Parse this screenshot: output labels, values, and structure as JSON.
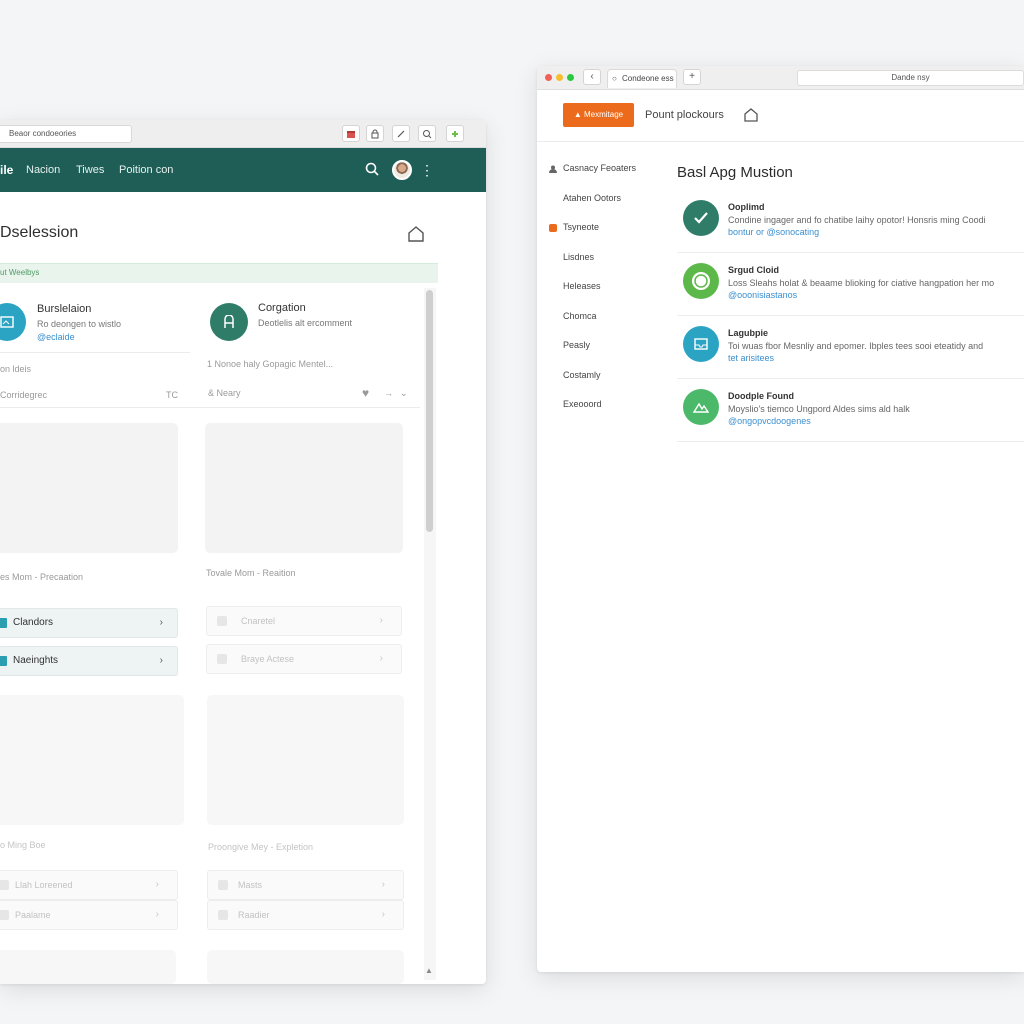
{
  "left_window": {
    "address": "Beaor condoeories",
    "chrome_icons": [
      "calendar-icon",
      "lock-icon",
      "tools-icon",
      "search-icon",
      "extension-icon"
    ],
    "app_logo": "ile",
    "nav": [
      "Nacion",
      "Tiwes",
      "Poition con"
    ],
    "page_title": "Dselession",
    "banner": "ut Weelbys",
    "card_a": {
      "title": "Burslelaion",
      "subtitle": "Ro deongen to wistlo",
      "link": "@eclaide"
    },
    "card_b": {
      "title": "Corgation",
      "subtitle": "Deotlelis alt ercomment"
    },
    "row_a_label": "on ldeis",
    "row_b_text": "1 Nonoe haly Gopagic Mentel...",
    "filter_a_label": "Corridegrec",
    "filter_a_value": "TC",
    "filter_b_label": "& Neary",
    "caption_1": "es Mom - Precaation",
    "caption_2": "Tovale Mom - Reaition",
    "btn_a1": "Clandors",
    "btn_a2": "Naeinghts",
    "btn_b1": "Cnaretel",
    "btn_b2": "Braye Actese",
    "caption_3": "o Ming Boe",
    "caption_4": "Proongive Mey - Expletion",
    "btn_c1": "Llah Loreened",
    "btn_c2": "Paalame",
    "btn_d1": "Masts",
    "btn_d2": "Raadier",
    "colors": {
      "bar": "#1e5e57",
      "accent": "#2b9fb0",
      "avatar_b": "#2f7d68",
      "banner_text": "#4e9a66"
    }
  },
  "right_window": {
    "tab_title": "Condeone ess",
    "address": "Dande nsy",
    "header_button": "Mexmitage",
    "header_title": "Pount plockours",
    "sidebar": [
      "Casnacy Feoaters",
      "Atahen Ootors",
      "Tsyneote",
      "Lisdnes",
      "Heleases",
      "Chomca",
      "Peasly",
      "Costamly",
      "Exeooord"
    ],
    "section_title": "Basl Apg Mustion",
    "items": [
      {
        "title": "Ooplimd",
        "desc": "Condine ingager and fo chatibe laihy opotor! Honsris ming Coodi",
        "link": "bontur or @sonocating",
        "color": "#2f7d68"
      },
      {
        "title": "Srgud Cloid",
        "desc": "Loss Sleahs holat & beaame blioking for ciative hangpation her mo",
        "link": "@ooonisiastanos",
        "color": "#5db84a"
      },
      {
        "title": "Lagubpie",
        "desc": "Toi wuas fbor Mesnliy and epomer. Ibples tees sooi eteatidy and",
        "link": "tet arisitees",
        "color": "#2ba3c2"
      },
      {
        "title": "Doodple Found",
        "desc": "Moyslio's tiemco Ungpord Aldes sims ald halk",
        "link": "@ongopvcdoogenes",
        "color": "#4cb86a"
      }
    ],
    "colors": {
      "header_button": "#ec6a1c",
      "sidebar_marker": "#ec6a1c"
    }
  }
}
